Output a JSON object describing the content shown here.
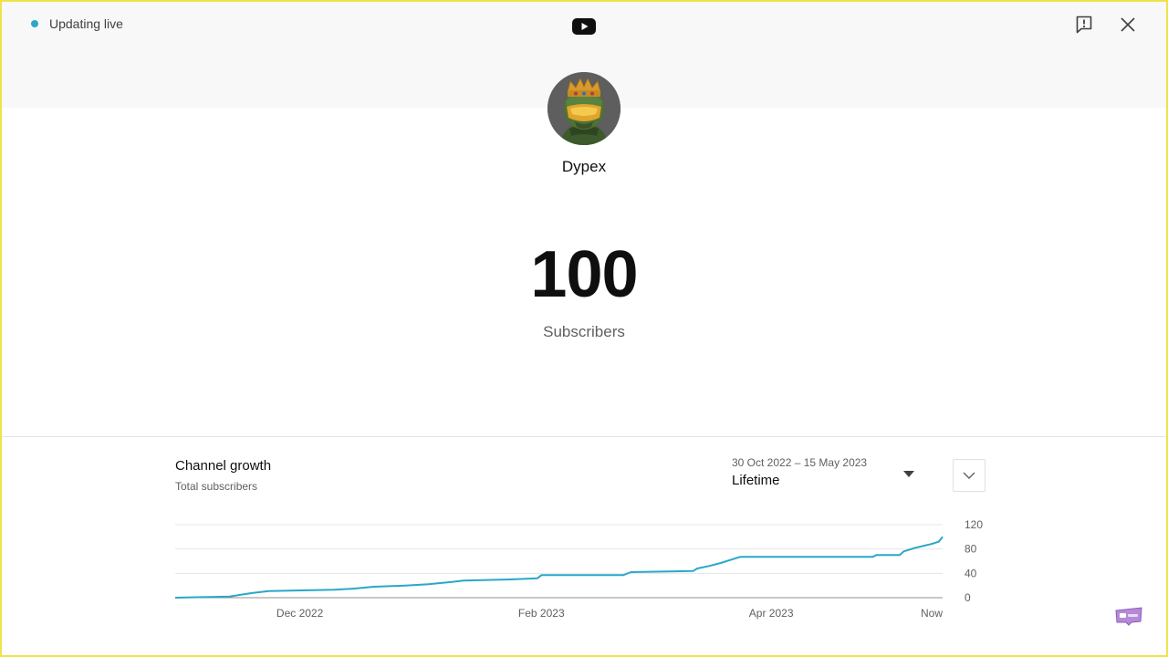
{
  "header": {
    "status_label": "Updating live",
    "status_color": "#2aa7c9",
    "logo_icon": "youtube-logo-icon",
    "feedback_icon": "feedback-icon",
    "close_icon": "close-icon"
  },
  "channel": {
    "name": "Dypex",
    "avatar": "channel-avatar"
  },
  "stats": {
    "subscriber_count": "100",
    "subscriber_label": "Subscribers"
  },
  "growth": {
    "title": "Channel growth",
    "subtitle": "Total subscribers",
    "date_range": "30 Oct 2022 – 15 May 2023",
    "range_option": "Lifetime",
    "expand_icon": "chevron-down-icon"
  },
  "chart_data": {
    "type": "line",
    "grid": true,
    "color": "#2aa7c9",
    "ylim": [
      0,
      120
    ],
    "yticks": [
      0,
      40,
      80,
      120
    ],
    "yticklabels": [
      "0",
      "40",
      "80",
      "120"
    ],
    "xlim": [
      "2022-10-30",
      "2023-05-15"
    ],
    "xticks": [
      "2022-12-01",
      "2023-02-01",
      "2023-04-01",
      "2023-05-15"
    ],
    "xticklabels": [
      "Dec 2022",
      "Feb 2023",
      "Apr 2023",
      "Now"
    ],
    "series": [
      {
        "x": [
          "2022-10-30",
          "2022-11-13",
          "2022-11-17",
          "2022-11-19",
          "2022-11-23",
          "2022-12-10",
          "2022-12-15",
          "2022-12-20",
          "2022-12-28",
          "2023-01-03",
          "2023-01-06",
          "2023-01-09",
          "2023-01-12",
          "2023-01-24",
          "2023-01-31",
          "2023-02-01",
          "2023-02-22",
          "2023-02-24",
          "2023-03-12",
          "2023-03-13",
          "2023-03-16",
          "2023-03-19",
          "2023-03-24",
          "2023-04-27",
          "2023-04-28",
          "2023-05-04",
          "2023-05-05",
          "2023-05-08",
          "2023-05-12",
          "2023-05-14",
          "2023-05-15"
        ],
        "y": [
          0,
          2,
          6,
          8,
          11,
          13,
          15,
          18,
          20,
          22,
          24,
          26,
          28,
          30,
          32,
          37,
          37,
          42,
          44,
          48,
          52,
          57,
          67,
          67,
          70,
          70,
          76,
          82,
          88,
          92,
          100
        ]
      }
    ]
  }
}
